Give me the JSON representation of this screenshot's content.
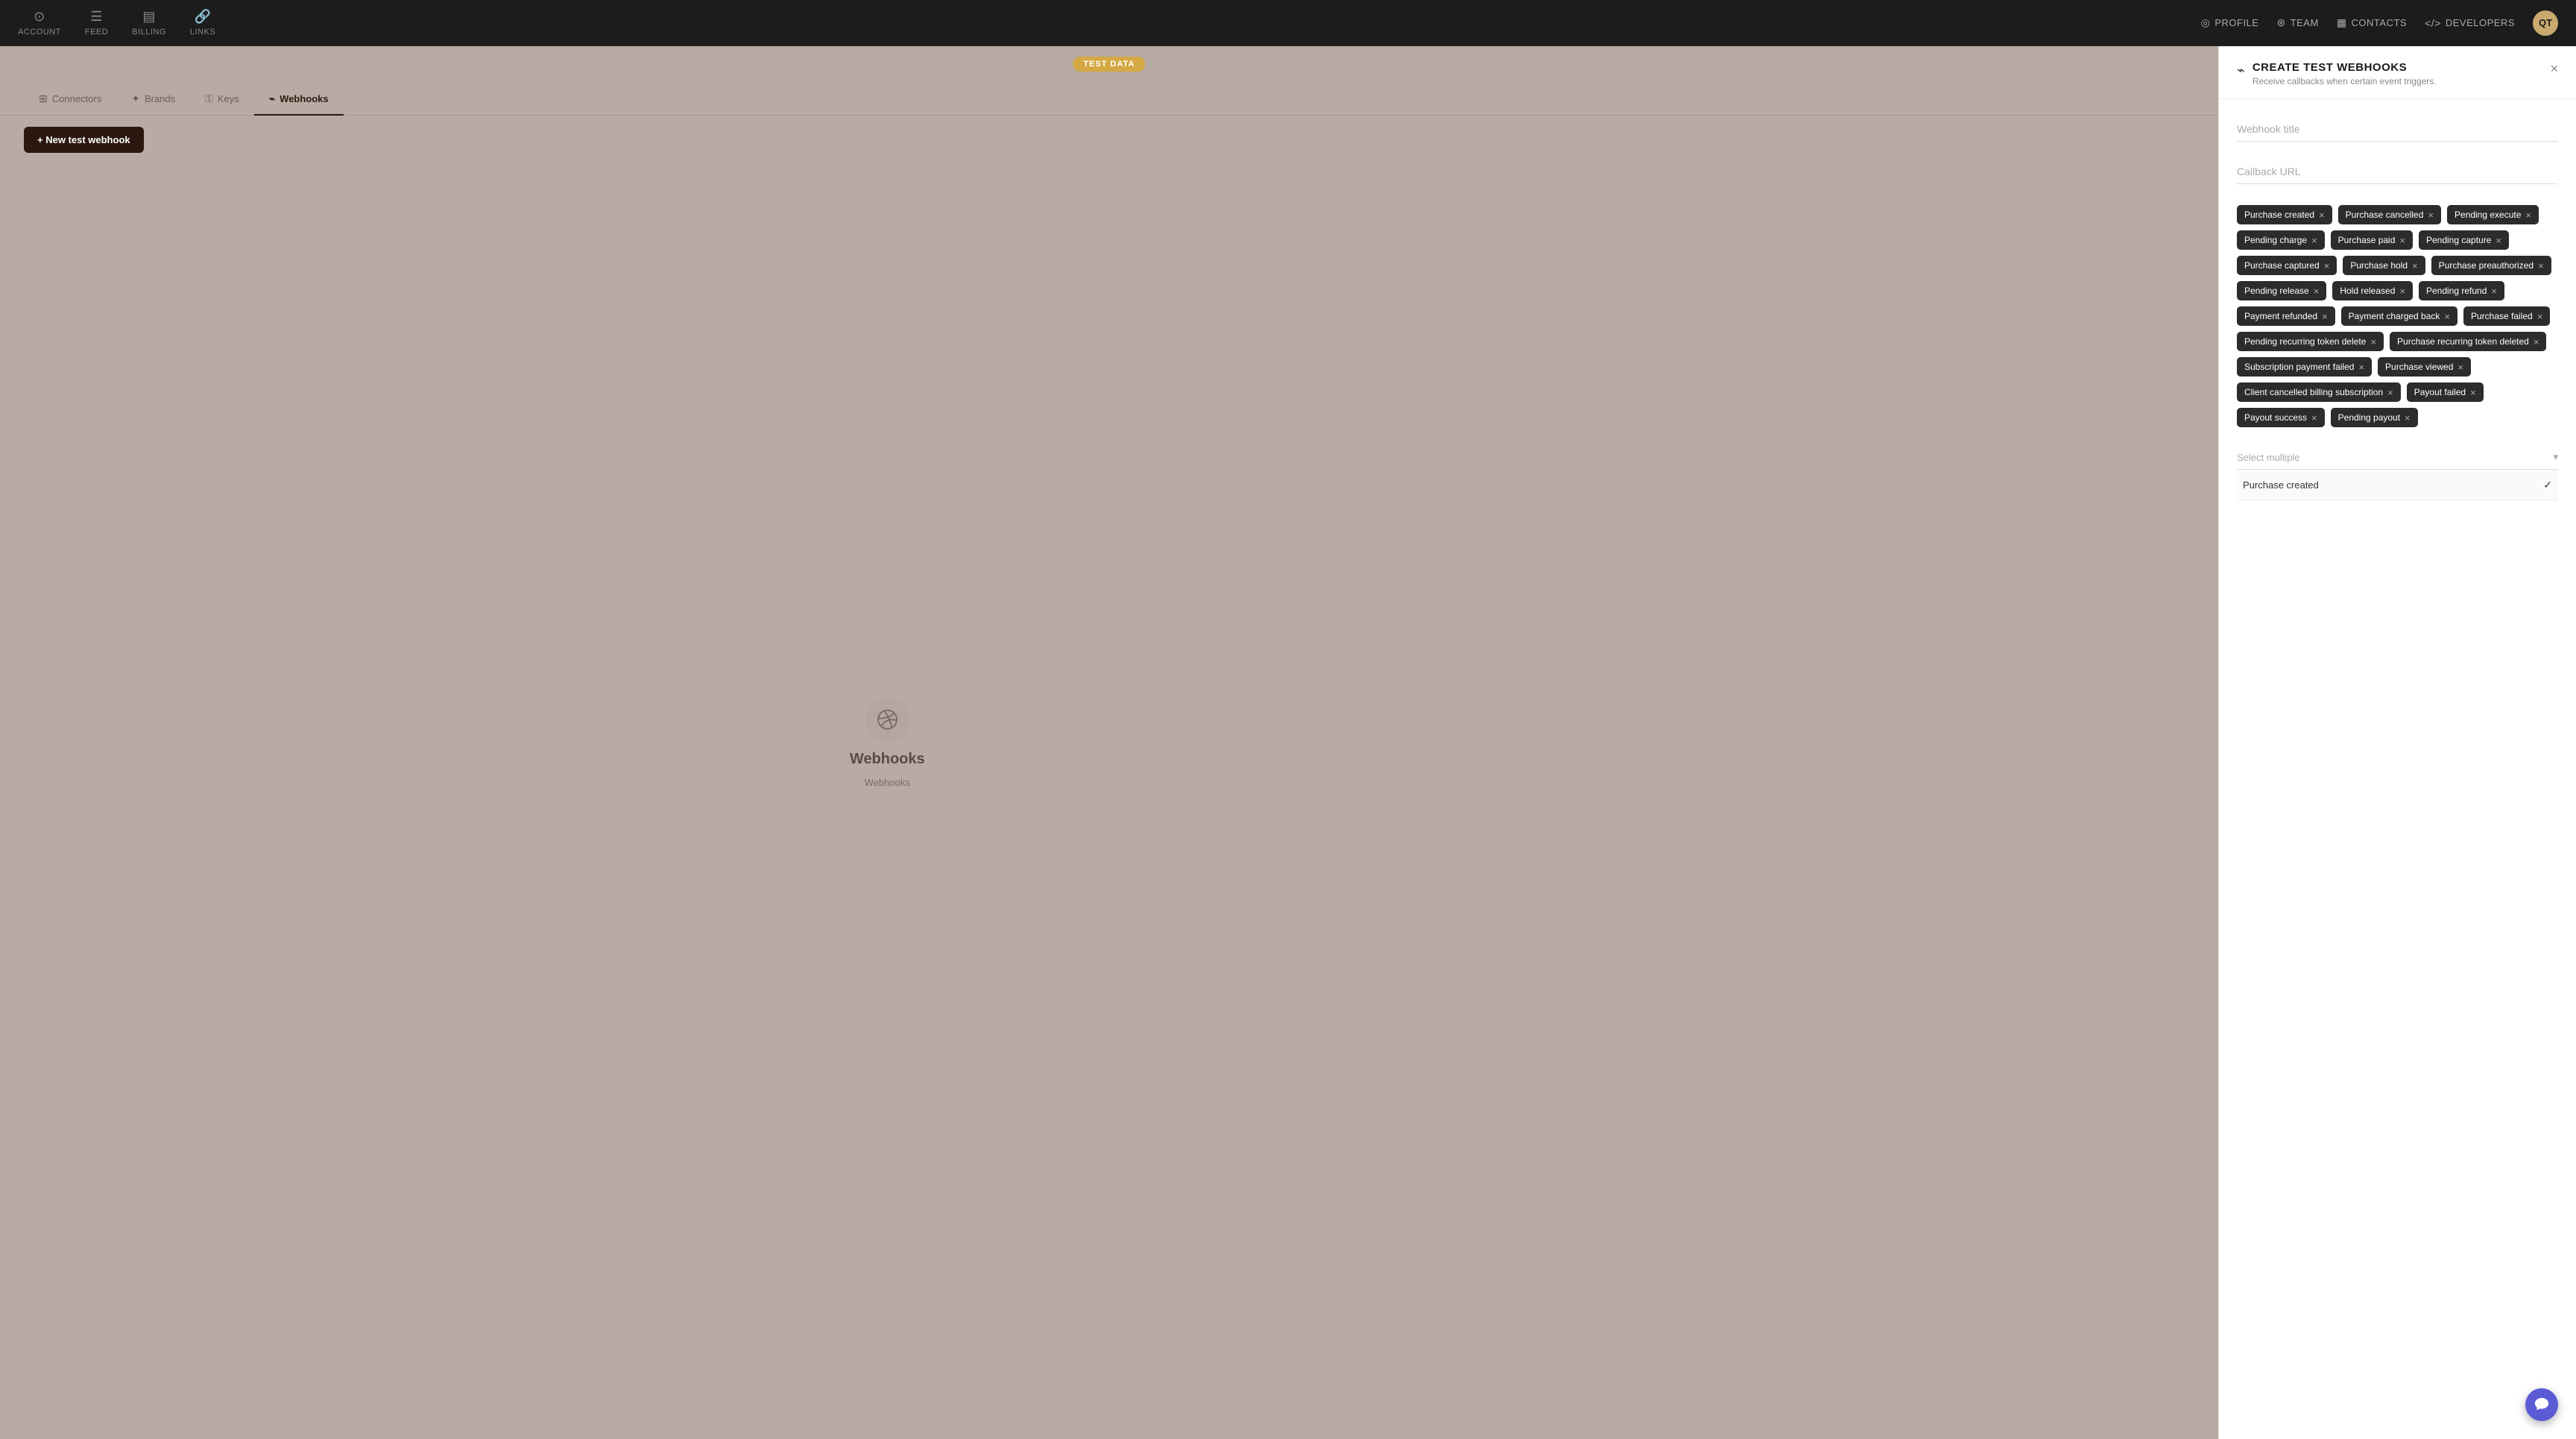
{
  "topNav": {
    "items": [
      {
        "id": "account",
        "label": "ACCOUNT",
        "icon": "⊙"
      },
      {
        "id": "feed",
        "label": "FEED",
        "icon": "☰"
      },
      {
        "id": "billing",
        "label": "BILLING",
        "icon": "▤"
      },
      {
        "id": "links",
        "label": "LINKS",
        "icon": "⊕"
      }
    ],
    "rightItems": [
      {
        "id": "profile",
        "label": "PROFILE",
        "icon": "◎"
      },
      {
        "id": "team",
        "label": "TEAM",
        "icon": "⊛"
      },
      {
        "id": "contacts",
        "label": "CONTACTS",
        "icon": "▦"
      },
      {
        "id": "developers",
        "label": "DEVELOPERS",
        "icon": "</>"
      }
    ],
    "avatarText": "QT"
  },
  "testDataBanner": "TEST DATA",
  "subTabs": [
    {
      "id": "connectors",
      "label": "Connectors",
      "icon": "⊞",
      "active": false
    },
    {
      "id": "brands",
      "label": "Brands",
      "icon": "✦",
      "active": false
    },
    {
      "id": "keys",
      "label": "Keys",
      "icon": "⚿",
      "active": false
    },
    {
      "id": "webhooks",
      "label": "Webhooks",
      "icon": "⌁",
      "active": true
    }
  ],
  "newWebhookButton": "+ New test webhook",
  "emptyState": {
    "title": "Webhooks",
    "subtitle": "Webhooks"
  },
  "panel": {
    "title": "CREATE TEST WEBHOOKS",
    "subtitle": "Receive callbacks when certain event triggers.",
    "webhookTitlePlaceholder": "Webhook title",
    "callbackUrlPlaceholder": "Callback URL",
    "tags": [
      {
        "id": "purchase-created",
        "label": "Purchase created"
      },
      {
        "id": "purchase-cancelled",
        "label": "Purchase cancelled"
      },
      {
        "id": "pending-execute",
        "label": "Pending execute"
      },
      {
        "id": "pending-charge",
        "label": "Pending charge"
      },
      {
        "id": "purchase-paid",
        "label": "Purchase paid"
      },
      {
        "id": "pending-capture",
        "label": "Pending capture"
      },
      {
        "id": "purchase-captured",
        "label": "Purchase captured"
      },
      {
        "id": "purchase-hold",
        "label": "Purchase hold"
      },
      {
        "id": "purchase-preauthorized",
        "label": "Purchase preauthorized"
      },
      {
        "id": "pending-release",
        "label": "Pending release"
      },
      {
        "id": "hold-released",
        "label": "Hold released"
      },
      {
        "id": "pending-refund",
        "label": "Pending refund"
      },
      {
        "id": "payment-refunded",
        "label": "Payment refunded"
      },
      {
        "id": "payment-charged-back",
        "label": "Payment charged back"
      },
      {
        "id": "purchase-failed",
        "label": "Purchase failed"
      },
      {
        "id": "pending-recurring-token-delete",
        "label": "Pending recurring token delete"
      },
      {
        "id": "purchase-recurring-token-deleted",
        "label": "Purchase recurring token deleted"
      },
      {
        "id": "subscription-payment-failed",
        "label": "Subscription payment failed"
      },
      {
        "id": "purchase-viewed",
        "label": "Purchase viewed"
      },
      {
        "id": "client-cancelled-billing-subscription",
        "label": "Client cancelled billing subscription"
      },
      {
        "id": "payout-failed",
        "label": "Payout failed"
      },
      {
        "id": "payout-success",
        "label": "Payout success"
      },
      {
        "id": "pending-payout",
        "label": "Pending payout"
      }
    ],
    "selectMultiplePlaceholder": "Select multiple",
    "dropdownItem": "Purchase created"
  }
}
